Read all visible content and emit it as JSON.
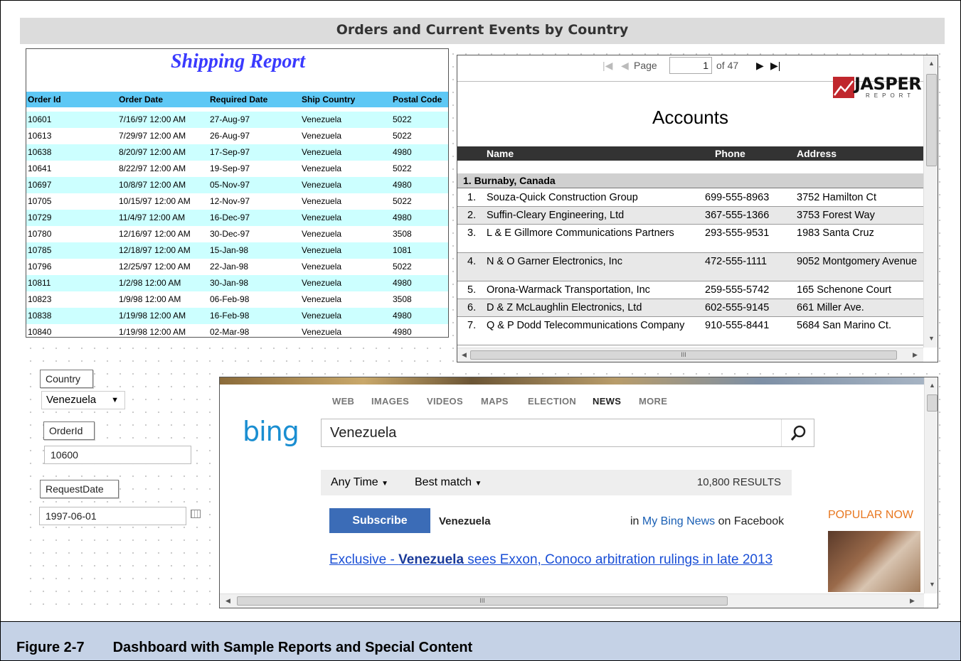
{
  "dashboard": {
    "title": "Orders and Current Events by Country"
  },
  "shipping_report": {
    "title": "Shipping Report",
    "columns": [
      "Order Id",
      "Order Date",
      "Required Date",
      "Ship Country",
      "Postal Code"
    ],
    "rows": [
      [
        "10601",
        "7/16/97 12:00 AM",
        "27-Aug-97",
        "Venezuela",
        "5022"
      ],
      [
        "10613",
        "7/29/97 12:00 AM",
        "26-Aug-97",
        "Venezuela",
        "5022"
      ],
      [
        "10638",
        "8/20/97 12:00 AM",
        "17-Sep-97",
        "Venezuela",
        "4980"
      ],
      [
        "10641",
        "8/22/97 12:00 AM",
        "19-Sep-97",
        "Venezuela",
        "5022"
      ],
      [
        "10697",
        "10/8/97 12:00 AM",
        "05-Nov-97",
        "Venezuela",
        "4980"
      ],
      [
        "10705",
        "10/15/97 12:00 AM",
        "12-Nov-97",
        "Venezuela",
        "5022"
      ],
      [
        "10729",
        "11/4/97 12:00 AM",
        "16-Dec-97",
        "Venezuela",
        "4980"
      ],
      [
        "10780",
        "12/16/97 12:00 AM",
        "30-Dec-97",
        "Venezuela",
        "3508"
      ],
      [
        "10785",
        "12/18/97 12:00 AM",
        "15-Jan-98",
        "Venezuela",
        "1081"
      ],
      [
        "10796",
        "12/25/97 12:00 AM",
        "22-Jan-98",
        "Venezuela",
        "5022"
      ],
      [
        "10811",
        "1/2/98 12:00 AM",
        "30-Jan-98",
        "Venezuela",
        "4980"
      ],
      [
        "10823",
        "1/9/98 12:00 AM",
        "06-Feb-98",
        "Venezuela",
        "3508"
      ],
      [
        "10838",
        "1/19/98 12:00 AM",
        "16-Feb-98",
        "Venezuela",
        "4980"
      ],
      [
        "10840",
        "1/19/98 12:00 AM",
        "02-Mar-98",
        "Venezuela",
        "4980"
      ]
    ]
  },
  "accounts_report": {
    "pager": {
      "page_label": "Page",
      "page_value": "1",
      "of_label": "of 47"
    },
    "logo": {
      "word": "JASPER",
      "sub": "REPORT"
    },
    "title": "Accounts",
    "columns": [
      "Name",
      "Phone",
      "Address"
    ],
    "group": "1. Burnaby, Canada",
    "rows": [
      [
        "1.",
        "Souza-Quick Construction Group",
        "699-555-8963",
        "3752 Hamilton Ct"
      ],
      [
        "2.",
        "Suffin-Cleary Engineering, Ltd",
        "367-555-1366",
        "3753 Forest Way"
      ],
      [
        "3.",
        "L & E Gillmore Communications Partners",
        "293-555-9531",
        "1983 Santa Cruz"
      ],
      [
        "4.",
        "N & O Garner Electronics, Inc",
        "472-555-1111",
        "9052 Montgomery Avenue"
      ],
      [
        "5.",
        "Orona-Warmack Transportation, Inc",
        "259-555-5742",
        "165 Schenone Court"
      ],
      [
        "6.",
        "D & Z McLaughlin Electronics, Ltd",
        "602-555-9145",
        "661 Miller Ave."
      ],
      [
        "7.",
        "Q & P Dodd Telecommunications Company",
        "910-555-8441",
        "5684 San Marino Ct."
      ]
    ],
    "hscroll_label": "III"
  },
  "controls": {
    "country_label": "Country",
    "country_value": "Venezuela",
    "orderid_label": "OrderId",
    "orderid_value": "10600",
    "requestdate_label": "RequestDate",
    "requestdate_value": "1997-06-01"
  },
  "bing": {
    "nav": [
      "WEB",
      "IMAGES",
      "VIDEOS",
      "MAPS",
      "ELECTION",
      "NEWS",
      "MORE"
    ],
    "active_nav": "NEWS",
    "logo": "bing",
    "query": "Venezuela",
    "filter_time": "Any Time",
    "filter_sort": "Best match",
    "results": "10,800 RESULTS",
    "subscribe": "Subscribe",
    "topic": "Venezuela",
    "fb_prefix": "in",
    "fb_link": "My Bing News",
    "fb_suffix": "on Facebook",
    "popular": "POPULAR NOW",
    "headline_prefix": "Exclusive - ",
    "headline_bold": "Venezuela",
    "headline_rest": " sees Exxon, Conoco arbitration rulings in late 2013",
    "hscroll_label": "III"
  },
  "caption": {
    "figure": "Figure 2-7",
    "text": "Dashboard with Sample Reports and Special Content"
  },
  "colors": {
    "ship_header": "#5ec8f5",
    "ship_alt_row": "#ccffff",
    "ship_title": "#3a3aff",
    "bing_blue": "#1a8ed1",
    "caption_bg": "#c5d2e6"
  }
}
